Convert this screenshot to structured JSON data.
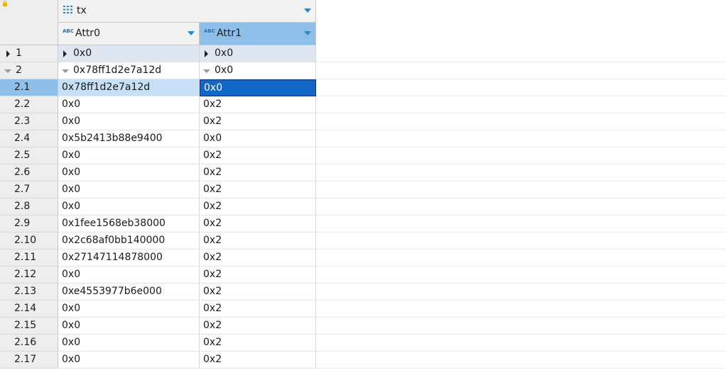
{
  "group_header": {
    "label": "tx"
  },
  "columns": [
    {
      "label": "Attr0",
      "type_icon": "ABC"
    },
    {
      "label": "Attr1",
      "type_icon": "ABC"
    }
  ],
  "rows": [
    {
      "id": "1",
      "kind": "collapsed",
      "attr0": "0x0",
      "attr1": "0x0"
    },
    {
      "id": "2",
      "kind": "expanded",
      "attr0": "0x78ff1d2e7a12d",
      "attr1": "0x0"
    },
    {
      "id": "2.1",
      "kind": "child",
      "attr0": "0x78ff1d2e7a12d",
      "attr1": "0x0"
    },
    {
      "id": "2.2",
      "kind": "child",
      "attr0": "0x0",
      "attr1": "0x2"
    },
    {
      "id": "2.3",
      "kind": "child",
      "attr0": "0x0",
      "attr1": "0x2"
    },
    {
      "id": "2.4",
      "kind": "child",
      "attr0": "0x5b2413b88e9400",
      "attr1": "0x0"
    },
    {
      "id": "2.5",
      "kind": "child",
      "attr0": "0x0",
      "attr1": "0x2"
    },
    {
      "id": "2.6",
      "kind": "child",
      "attr0": "0x0",
      "attr1": "0x2"
    },
    {
      "id": "2.7",
      "kind": "child",
      "attr0": "0x0",
      "attr1": "0x2"
    },
    {
      "id": "2.8",
      "kind": "child",
      "attr0": "0x0",
      "attr1": "0x2"
    },
    {
      "id": "2.9",
      "kind": "child",
      "attr0": "0x1fee1568eb38000",
      "attr1": "0x2"
    },
    {
      "id": "2.10",
      "kind": "child",
      "attr0": "0x2c68af0bb140000",
      "attr1": "0x2"
    },
    {
      "id": "2.11",
      "kind": "child",
      "attr0": "0x27147114878000",
      "attr1": "0x2"
    },
    {
      "id": "2.12",
      "kind": "child",
      "attr0": "0x0",
      "attr1": "0x2"
    },
    {
      "id": "2.13",
      "kind": "child",
      "attr0": "0xe4553977b6e000",
      "attr1": "0x2"
    },
    {
      "id": "2.14",
      "kind": "child",
      "attr0": "0x0",
      "attr1": "0x2"
    },
    {
      "id": "2.15",
      "kind": "child",
      "attr0": "0x0",
      "attr1": "0x2"
    },
    {
      "id": "2.16",
      "kind": "child",
      "attr0": "0x0",
      "attr1": "0x2"
    },
    {
      "id": "2.17",
      "kind": "child",
      "attr0": "0x0",
      "attr1": "0x2"
    }
  ],
  "selection": {
    "row": "2.1",
    "column": "Attr1"
  },
  "colors": {
    "header_bg": "#f2f2f2",
    "selected_header": "#8dbfe9",
    "focus_cell": "#1266c8",
    "parent_row": "#dde6f1",
    "accent_arrow": "#2a88c8"
  }
}
